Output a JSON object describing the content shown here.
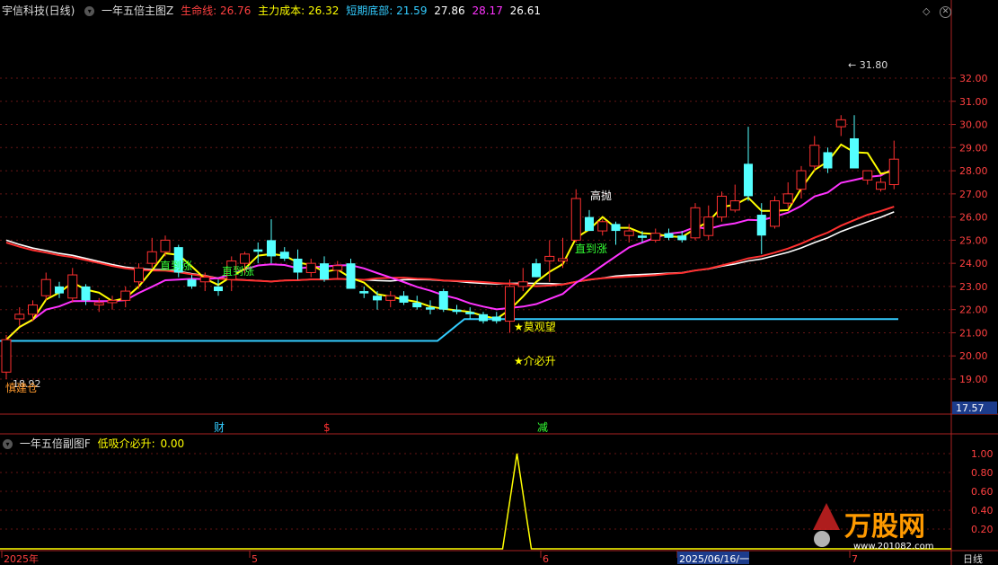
{
  "header": {
    "stock_name": "宇信科技(日线)",
    "main_indicator": "一年五倍主图Z",
    "items": [
      {
        "label": "生命线:",
        "value": "26.76",
        "color": "#ff4040"
      },
      {
        "label": "主力成本:",
        "value": "26.32",
        "color": "#ffff00"
      },
      {
        "label": "短期底部:",
        "value": "21.59",
        "color": "#33ccff"
      },
      {
        "label": "",
        "value": "27.86",
        "color": "#ffffff"
      },
      {
        "label": "",
        "value": "28.17",
        "color": "#ff33ff"
      },
      {
        "label": "",
        "value": "26.61",
        "color": "#ffffff"
      }
    ],
    "controls": {
      "diamond_icon": "diamond-icon",
      "close_icon": "close-icon"
    }
  },
  "price_axis": {
    "ticks": [
      "32.00",
      "31.00",
      "30.00",
      "29.00",
      "28.00",
      "27.00",
      "26.00",
      "25.00",
      "24.00",
      "23.00",
      "22.00",
      "21.00",
      "20.00",
      "19.00"
    ],
    "current_price": "17.57"
  },
  "annotations": {
    "high_label": "31.80",
    "low_label": "18.92",
    "signal_texts": [
      "慎建仓",
      "直到涨",
      "直到涨",
      "直到涨",
      "高抛",
      "莫观望",
      "介必升"
    ],
    "event_markers": [
      "财",
      "$",
      "减"
    ]
  },
  "sub_header": {
    "indicator": "一年五倍副图F",
    "item_label": "低吸介必升:",
    "item_value": "0.00"
  },
  "sub_axis": {
    "ticks": [
      "1.00",
      "0.80",
      "0.60",
      "0.40",
      "0.20"
    ]
  },
  "time_axis": {
    "labels": [
      "2025年",
      "5",
      "6",
      "2025/06/16/一",
      "7"
    ],
    "period": "日线"
  },
  "watermark": {
    "brand": "万股网",
    "url": "www.201082.com"
  },
  "colors": {
    "up": "#ff3030",
    "down": "#54ffff",
    "lifeline": "#ff3030",
    "cost": "#ffff00",
    "bottom": "#33ccff",
    "ma_white": "#ffffff",
    "ma_pink": "#ff33ff"
  },
  "chart_data": {
    "type": "candlestick",
    "ohlc": [
      [
        19.3,
        20.9,
        19.0,
        20.7
      ],
      [
        21.6,
        22.1,
        21.3,
        21.8
      ],
      [
        21.8,
        22.4,
        21.5,
        22.2
      ],
      [
        22.6,
        23.6,
        22.4,
        23.3
      ],
      [
        23.0,
        23.2,
        22.5,
        22.7
      ],
      [
        22.5,
        23.8,
        22.3,
        23.5
      ],
      [
        23.0,
        23.1,
        22.2,
        22.4
      ],
      [
        22.2,
        22.5,
        21.9,
        22.3
      ],
      [
        22.3,
        22.6,
        22.0,
        22.4
      ],
      [
        22.4,
        23.0,
        22.1,
        22.8
      ],
      [
        23.2,
        24.0,
        22.9,
        23.8
      ],
      [
        24.0,
        25.1,
        23.8,
        24.5
      ],
      [
        24.5,
        25.2,
        24.3,
        25.0
      ],
      [
        24.7,
        24.8,
        23.4,
        23.6
      ],
      [
        23.3,
        23.5,
        22.9,
        23.0
      ],
      [
        23.2,
        23.6,
        22.8,
        23.4
      ],
      [
        23.0,
        23.3,
        22.6,
        22.8
      ],
      [
        23.3,
        24.3,
        22.8,
        24.1
      ],
      [
        24.0,
        24.5,
        23.5,
        24.4
      ],
      [
        24.6,
        24.9,
        24.0,
        24.5
      ],
      [
        25.0,
        25.9,
        24.0,
        24.3
      ],
      [
        24.5,
        24.7,
        24.1,
        24.2
      ],
      [
        24.2,
        24.6,
        23.3,
        23.6
      ],
      [
        23.6,
        24.2,
        23.4,
        24.0
      ],
      [
        24.0,
        24.3,
        23.2,
        23.3
      ],
      [
        23.7,
        24.1,
        23.3,
        23.9
      ],
      [
        24.0,
        24.2,
        22.9,
        22.9
      ],
      [
        22.8,
        23.0,
        22.5,
        22.7
      ],
      [
        22.6,
        22.8,
        22.0,
        22.4
      ],
      [
        22.4,
        22.8,
        22.1,
        22.6
      ],
      [
        22.6,
        22.8,
        22.2,
        22.3
      ],
      [
        22.3,
        22.6,
        22.0,
        22.1
      ],
      [
        22.1,
        22.4,
        21.8,
        22.0
      ],
      [
        22.8,
        22.9,
        21.9,
        22.0
      ],
      [
        22.0,
        22.2,
        21.8,
        21.9
      ],
      [
        21.9,
        22.1,
        21.6,
        21.8
      ],
      [
        21.8,
        21.9,
        21.4,
        21.5
      ],
      [
        21.7,
        21.9,
        21.4,
        21.5
      ],
      [
        21.5,
        23.3,
        21.0,
        23.0
      ],
      [
        23.0,
        23.8,
        22.8,
        23.2
      ],
      [
        24.0,
        24.2,
        23.4,
        23.4
      ],
      [
        24.1,
        25.0,
        23.2,
        24.3
      ],
      [
        24.1,
        25.1,
        23.8,
        24.2
      ],
      [
        25.0,
        27.2,
        24.9,
        26.8
      ],
      [
        26.0,
        26.3,
        25.4,
        25.4
      ],
      [
        25.4,
        25.9,
        25.2,
        25.8
      ],
      [
        25.7,
        25.8,
        24.8,
        25.4
      ],
      [
        25.2,
        25.7,
        24.9,
        25.4
      ],
      [
        25.2,
        25.4,
        24.9,
        25.1
      ],
      [
        25.0,
        25.5,
        24.9,
        25.3
      ],
      [
        25.3,
        25.5,
        25.0,
        25.1
      ],
      [
        25.2,
        25.4,
        24.9,
        25.0
      ],
      [
        25.1,
        26.6,
        25.0,
        26.4
      ],
      [
        25.2,
        26.5,
        25.0,
        26.0
      ],
      [
        26.0,
        27.1,
        25.8,
        26.9
      ],
      [
        26.3,
        27.4,
        26.2,
        26.7
      ],
      [
        28.3,
        29.9,
        26.7,
        26.9
      ],
      [
        26.1,
        26.6,
        24.4,
        25.2
      ],
      [
        25.6,
        26.9,
        25.5,
        26.7
      ],
      [
        26.6,
        27.5,
        26.4,
        27.0
      ],
      [
        27.2,
        28.2,
        26.8,
        28.0
      ],
      [
        28.2,
        29.5,
        28.0,
        29.1
      ],
      [
        28.8,
        29.0,
        27.9,
        28.1
      ],
      [
        29.9,
        30.4,
        29.5,
        30.2
      ],
      [
        29.4,
        30.4,
        28.1,
        28.1
      ],
      [
        27.6,
        28.0,
        27.4,
        28.0
      ],
      [
        27.2,
        27.7,
        27.1,
        27.5
      ],
      [
        27.4,
        29.3,
        27.2,
        28.5
      ]
    ],
    "price_range": [
      18.5,
      32.6
    ],
    "sub_series": {
      "name": "低吸介必升",
      "spike_index": 38,
      "spike_value": 1.0,
      "ylim": [
        0,
        1.1
      ]
    }
  }
}
